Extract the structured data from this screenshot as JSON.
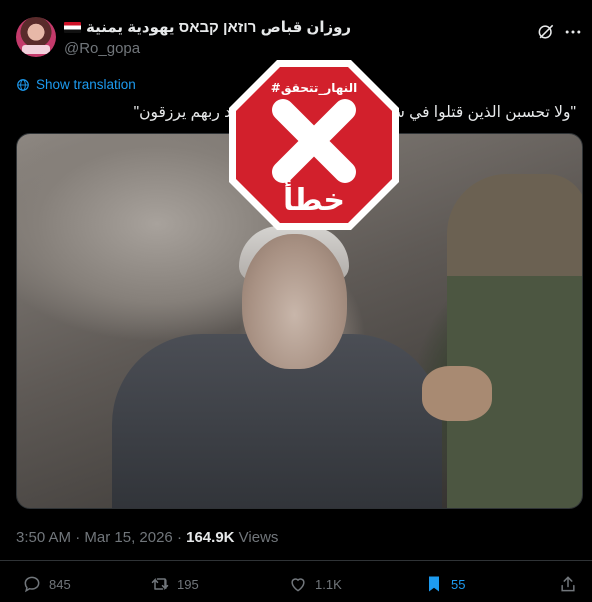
{
  "author": {
    "display_name": "روزان قباص רוזאן קבאס يهودية يمنية",
    "handle": "@Ro_gopa"
  },
  "translate": {
    "label": "Show translation"
  },
  "tweet": {
    "text": "\"ولا تحسبن الذين قتلوا في سبيل الله أمواتا بل أحياء عند ربهم يرزقون\""
  },
  "stamp": {
    "hashtag": "#النهار_تتحقق",
    "verdict": "خطأ",
    "color": "#d2202c"
  },
  "meta": {
    "time": "3:50 AM",
    "separator": "·",
    "date": "Mar 15, 2026",
    "views_count": "164.9K",
    "views_label": "Views"
  },
  "actions": {
    "replies": "845",
    "reposts": "195",
    "likes": "1.1K",
    "bookmarks": "55"
  },
  "icons": [
    "grok-icon",
    "more-icon",
    "globe-icon",
    "reply-icon",
    "repost-icon",
    "like-icon",
    "bookmark-icon",
    "share-icon"
  ],
  "colors": {
    "accent": "#1d9bf0",
    "muted": "#71767b",
    "text": "#e7e9ea",
    "background": "#000000"
  }
}
